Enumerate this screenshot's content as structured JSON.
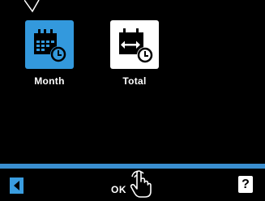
{
  "tiles": [
    {
      "label": "Month",
      "selected": true,
      "color": "#3399dd",
      "icon": "calendar-clock-icon"
    },
    {
      "label": "Total",
      "selected": false,
      "color": "#ffffff",
      "icon": "calendar-range-clock-icon"
    }
  ],
  "footer": {
    "back_icon": "back-arrow-icon",
    "ok_label": "OK",
    "ok_icon": "touch-hand-icon",
    "help_label": "?"
  },
  "colors": {
    "accent": "#3399dd",
    "background": "#000000",
    "divider": "#3a8fd0"
  }
}
